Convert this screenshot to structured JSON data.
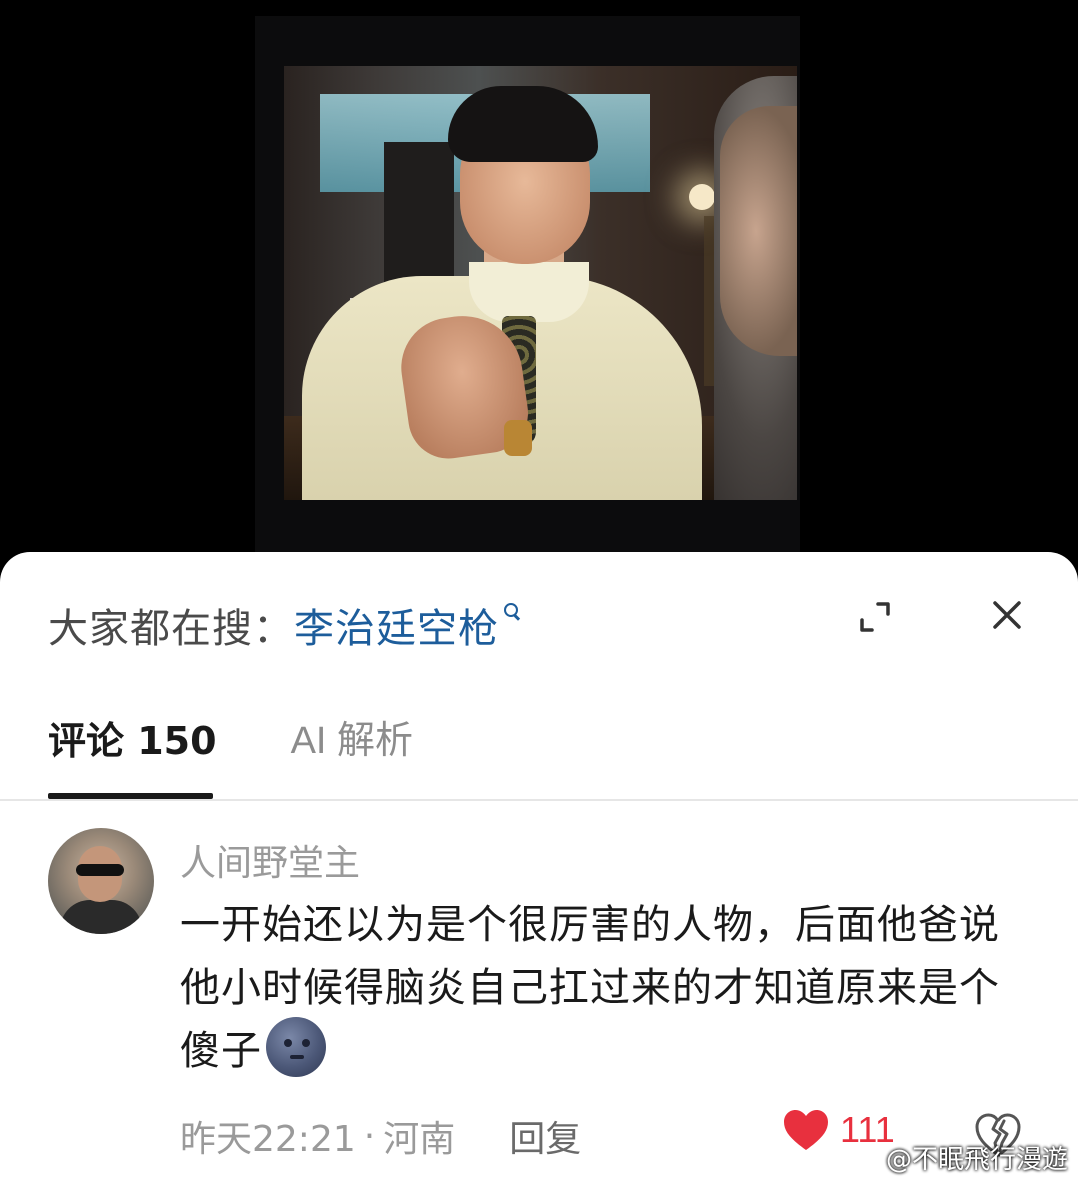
{
  "search": {
    "prefix": "大家都在搜：",
    "term": "李治廷空枪"
  },
  "tabs": [
    {
      "label": "评论 150",
      "active": true
    },
    {
      "label": "AI 解析",
      "active": false
    }
  ],
  "comment": {
    "username": "人间野堂主",
    "text": "一开始还以为是个很厉害的人物，后面他爸说他小时候得脑炎自己扛过来的才知道原来是个傻子",
    "emoji": "new-moon-face",
    "time": "昨天22:21",
    "separator": "·",
    "location": "河南",
    "reply_label": "回复",
    "likes": "111"
  },
  "watermark": "@不眠飛行漫遊",
  "colors": {
    "search_term": "#1d5d9b",
    "like": "#e8303e",
    "text": "#1a1a1a",
    "muted": "#9a9a9a"
  }
}
